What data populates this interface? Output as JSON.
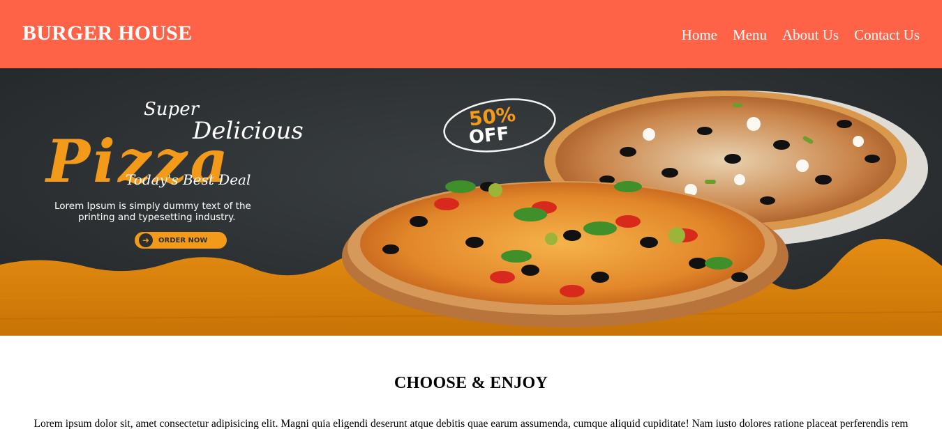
{
  "header": {
    "brand": "BURGER HOUSE",
    "nav": [
      "Home",
      "Menu",
      "About Us",
      "Contact Us"
    ]
  },
  "banner": {
    "script_top": "Super",
    "script_mid": "Delicious",
    "headline": "Pizza",
    "tagline": "Today's Best Deal",
    "description_line1": "Lorem Ipsum is simply dummy text of the",
    "description_line2": "printing and typesetting industry.",
    "cta": "ORDER NOW",
    "discount_value": "50%",
    "discount_label": "OFF"
  },
  "section": {
    "title": "CHOOSE & ENJOY",
    "body": "Lorem ipsum dolor sit, amet consectetur adipisicing elit. Magni quia eligendi deserunt atque debitis quae earum assumenda, cumque aliquid cupiditate! Nam iusto dolores ratione placeat perferendis rem"
  },
  "colors": {
    "header_bg": "#ff6347",
    "accent_orange": "#f39a1a",
    "board_dark": "#2b2f31"
  }
}
